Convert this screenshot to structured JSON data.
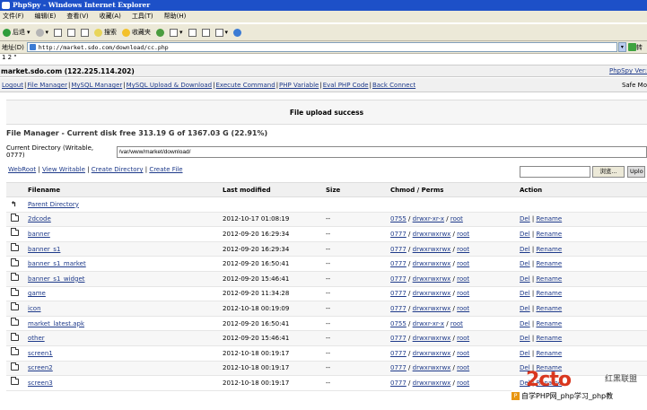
{
  "window": {
    "title": "PhpSpy - Windows Internet Explorer"
  },
  "menu": [
    "文件(F)",
    "编辑(E)",
    "查看(V)",
    "收藏(A)",
    "工具(T)",
    "帮助(H)"
  ],
  "toolbar": {
    "back": "后退",
    "search": "搜索",
    "favorites": "收藏夹"
  },
  "address": {
    "label": "地址(D)",
    "url": "http://market.sdo.com/download/cc.php",
    "go": "转"
  },
  "pre_text": "1 2 \"",
  "header": {
    "host": "market.sdo.com (122.225.114.202)",
    "version": "PhpSpy Ver:"
  },
  "nav": {
    "items": [
      "Logout",
      "File Manager",
      "MySQL Manager",
      "MySQL Upload & Download",
      "Execute Command",
      "PHP Variable",
      "Eval PHP Code",
      "Back Connect"
    ],
    "safe_mode": "Safe Mo"
  },
  "notice": "File upload success",
  "file_manager": {
    "title": "File Manager - Current disk free 313.19 G of 1367.03 G (22.91%)",
    "current_dir_label": "Current Directory (Writable, 0777)",
    "current_dir_value": "/var/www/market/download/",
    "links": [
      "WebRoot",
      "View Writable",
      "Create Directory",
      "Create File"
    ],
    "browse_label": "浏览...",
    "upload_label": "Uplo",
    "columns": [
      "Filename",
      "Last modified",
      "Size",
      "Chmod / Perms",
      "Action"
    ],
    "parent": "Parent Directory",
    "del": "Del",
    "rename": "Rename",
    "rows": [
      {
        "name": "2dcode",
        "modified": "2012-10-17 01:08:19",
        "size": "--",
        "chmod": "0755",
        "perms": "drwxr-xr-x",
        "owner": "root"
      },
      {
        "name": "banner",
        "modified": "2012-09-20 16:29:34",
        "size": "--",
        "chmod": "0777",
        "perms": "drwxrwxrwx",
        "owner": "root"
      },
      {
        "name": "banner_s1",
        "modified": "2012-09-20 16:29:34",
        "size": "--",
        "chmod": "0777",
        "perms": "drwxrwxrwx",
        "owner": "root"
      },
      {
        "name": "banner_s1_market",
        "modified": "2012-09-20 16:50:41",
        "size": "--",
        "chmod": "0777",
        "perms": "drwxrwxrwx",
        "owner": "root"
      },
      {
        "name": "banner_s1_widget",
        "modified": "2012-09-20 15:46:41",
        "size": "--",
        "chmod": "0777",
        "perms": "drwxrwxrwx",
        "owner": "root"
      },
      {
        "name": "game",
        "modified": "2012-09-20 11:34:28",
        "size": "--",
        "chmod": "0777",
        "perms": "drwxrwxrwx",
        "owner": "root"
      },
      {
        "name": "icon",
        "modified": "2012-10-18 00:19:09",
        "size": "--",
        "chmod": "0777",
        "perms": "drwxrwxrwx",
        "owner": "root"
      },
      {
        "name": "market_latest.apk",
        "modified": "2012-09-20 16:50:41",
        "size": "--",
        "chmod": "0755",
        "perms": "drwxr-xr-x",
        "owner": "root"
      },
      {
        "name": "other",
        "modified": "2012-09-20 15:46:41",
        "size": "--",
        "chmod": "0777",
        "perms": "drwxrwxrwx",
        "owner": "root"
      },
      {
        "name": "screen1",
        "modified": "2012-10-18 00:19:17",
        "size": "--",
        "chmod": "0777",
        "perms": "drwxrwxrwx",
        "owner": "root"
      },
      {
        "name": "screen2",
        "modified": "2012-10-18 00:19:17",
        "size": "--",
        "chmod": "0777",
        "perms": "drwxrwxrwx",
        "owner": "root"
      },
      {
        "name": "screen3",
        "modified": "2012-10-18 00:19:17",
        "size": "--",
        "chmod": "0777",
        "perms": "drwxrwxrwx",
        "owner": "root"
      }
    ]
  },
  "watermark": {
    "logo": "2cto",
    "brand": "红黑联盟",
    "bar": "自学PHP网_php学习_php教"
  }
}
